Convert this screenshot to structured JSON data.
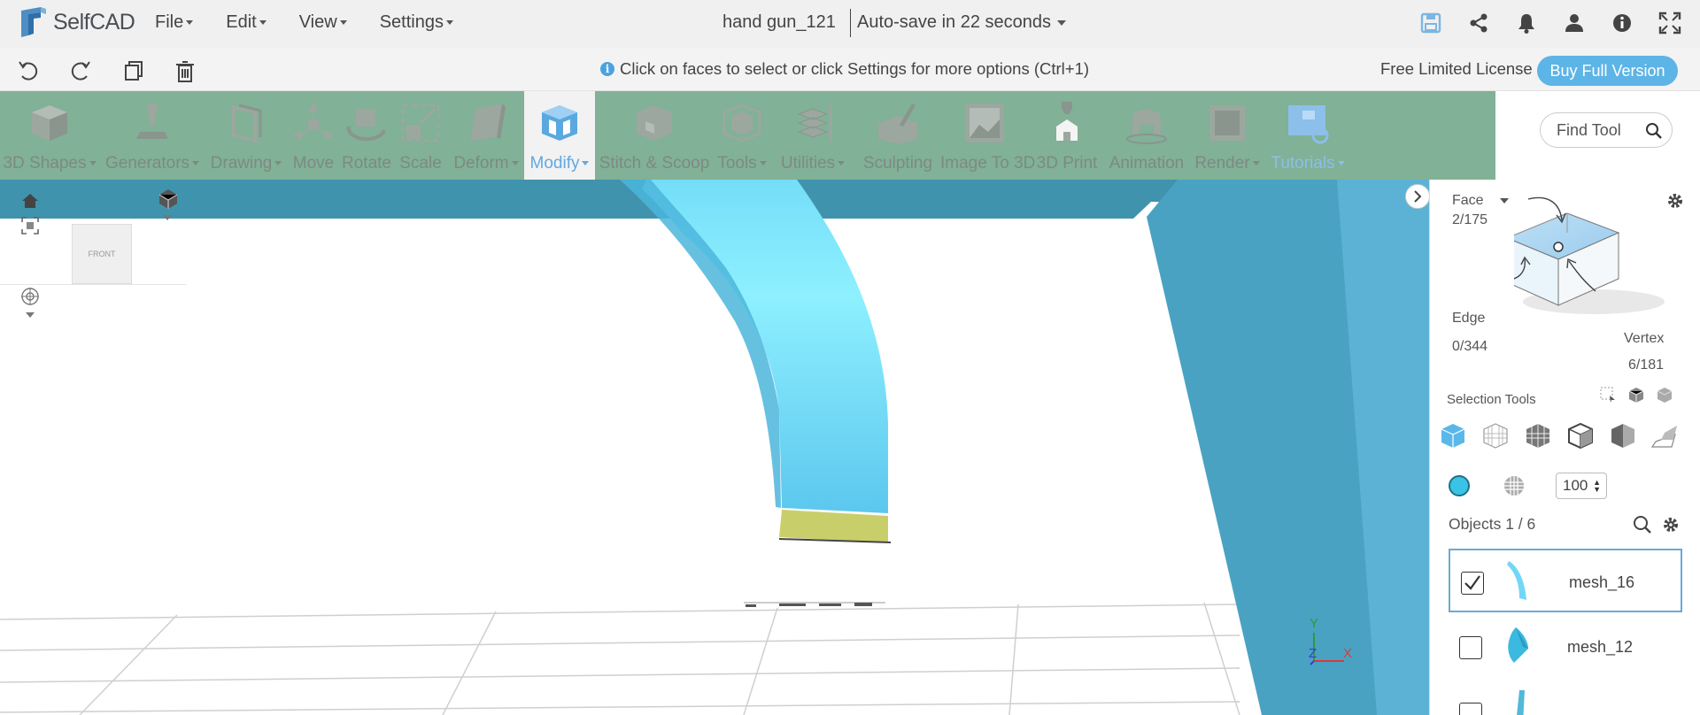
{
  "app": {
    "name": "SelfCAD"
  },
  "menu": [
    {
      "label": "File"
    },
    {
      "label": "Edit"
    },
    {
      "label": "View"
    },
    {
      "label": "Settings"
    }
  ],
  "document": {
    "title": "hand gun_121",
    "autosave": "Auto-save in 22 seconds"
  },
  "top_icons": [
    "save-icon",
    "share-icon",
    "bell-icon",
    "user-icon",
    "info-icon",
    "fullscreen-icon"
  ],
  "hint": "Click on faces to select or click Settings for more options (Ctrl+1)",
  "license": {
    "text": "Free Limited License",
    "buy_label": "Buy Full Version"
  },
  "toolbar": [
    {
      "label": "3D Shapes"
    },
    {
      "label": "Generators"
    },
    {
      "label": "Drawing"
    },
    {
      "label": "Move"
    },
    {
      "label": "Rotate"
    },
    {
      "label": "Scale"
    },
    {
      "label": "Deform"
    },
    {
      "label": "Modify"
    },
    {
      "label": "Stitch & Scoop"
    },
    {
      "label": "Tools"
    },
    {
      "label": "Utilities"
    },
    {
      "label": "Sculpting"
    },
    {
      "label": "Image To 3D"
    },
    {
      "label": "3D Print"
    },
    {
      "label": "Animation"
    },
    {
      "label": "Render"
    },
    {
      "label": "Tutorials"
    }
  ],
  "find_tool": {
    "placeholder": "Find Tool"
  },
  "viewport": {
    "view_cube_label": "FRONT",
    "axes": {
      "y": "Y",
      "z": "Z",
      "x": "X"
    }
  },
  "selection": {
    "face_label": "Face",
    "face_count": "2/175",
    "edge_label": "Edge",
    "edge_count": "0/344",
    "vertex_label": "Vertex",
    "vertex_count": "6/181",
    "tools_label": "Selection Tools",
    "color": "#39c3e6",
    "opacity": "100"
  },
  "objects": {
    "title": "Objects 1 / 6",
    "items": [
      {
        "name": "mesh_16",
        "checked": true
      },
      {
        "name": "mesh_12",
        "checked": false
      }
    ]
  },
  "colors": {
    "toolbar_bg": "#81b196",
    "accent": "#61a8e0",
    "model": "#5ed3f2",
    "face_selected": "#c8cf6a",
    "frame": "#4aa0bf"
  }
}
